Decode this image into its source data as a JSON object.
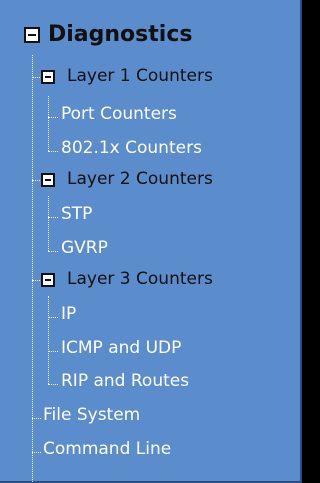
{
  "tree": {
    "root": {
      "label": "Diagnostics",
      "icon": "minus-box-icon",
      "expanded": true,
      "groups": [
        {
          "label": "Layer 1 Counters",
          "icon": "minus-box-icon",
          "expanded": true,
          "items": [
            "Port Counters",
            "802.1x Counters"
          ]
        },
        {
          "label": "Layer 2 Counters",
          "icon": "minus-box-icon",
          "expanded": true,
          "items": [
            "STP",
            "GVRP"
          ]
        },
        {
          "label": "Layer 3 Counters",
          "icon": "minus-box-icon",
          "expanded": true,
          "items": [
            "IP",
            "ICMP and UDP",
            "RIP and Routes"
          ]
        }
      ],
      "items": [
        "File System",
        "Command Line"
      ]
    },
    "colors": {
      "background": "#5b8ccc",
      "group_text": "#111111",
      "leaf_text": "#ffffff"
    }
  }
}
